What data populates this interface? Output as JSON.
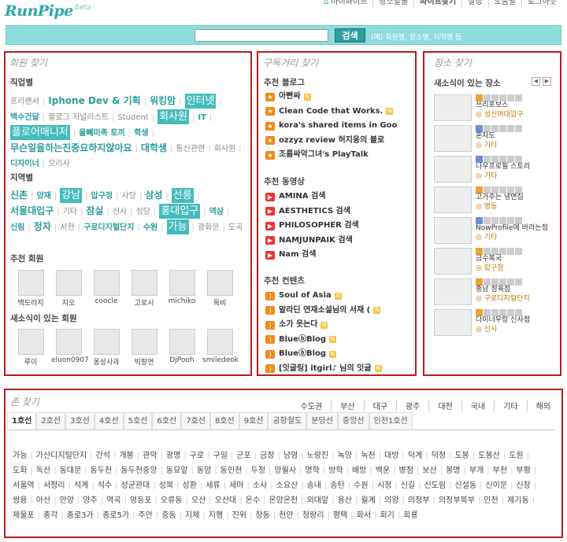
{
  "brand": {
    "name": "RunPipe",
    "beta": "Beta"
  },
  "topnav": [
    "마이파이프",
    "장소발굴",
    "파이프찾기",
    "설정",
    "도움말",
    "로그아웃"
  ],
  "search": {
    "button": "검색",
    "hint": "(예) 회원명, 장소명, 지역명 등",
    "placeholder": ""
  },
  "member": {
    "title": "회원 찾기",
    "job_title": "직업별",
    "jobs": [
      [
        "프리랜서",
        1
      ],
      [
        "Iphone Dev & 기획",
        3
      ],
      [
        "워킹맘",
        3
      ],
      [
        "인터넷",
        4
      ],
      [
        "백수건달",
        2
      ],
      [
        "블로그 저널리스트",
        1
      ],
      [
        "Student",
        1
      ],
      [
        "회사원",
        4
      ],
      [
        "IT",
        2
      ],
      [
        "플로어매니저",
        4
      ],
      [
        "올빼미족 토끼",
        2
      ],
      [
        "학생",
        2
      ],
      [
        "무슨일을하는진중요하지않아요",
        3
      ],
      [
        "대학생",
        3
      ],
      [
        "통신관련",
        1
      ],
      [
        "회사원",
        1
      ],
      [
        "디자이너",
        2
      ],
      [
        "오리사",
        1
      ]
    ],
    "region_title": "지역별",
    "regions": [
      [
        "신촌",
        3
      ],
      [
        "양재",
        2
      ],
      [
        "강남",
        4
      ],
      [
        "압구정",
        2
      ],
      [
        "사당",
        1
      ],
      [
        "삼성",
        3
      ],
      [
        "선릉",
        4
      ],
      [
        "서울대입구",
        3
      ],
      [
        "기타",
        1
      ],
      [
        "잠실",
        3
      ],
      [
        "신사",
        1
      ],
      [
        "성당",
        1
      ],
      [
        "홍대입구",
        4
      ],
      [
        "역삼",
        2
      ],
      [
        "신림",
        2
      ],
      [
        "정자",
        3
      ],
      [
        "서현",
        1
      ],
      [
        "구로디지털단지",
        2
      ],
      [
        "수원",
        2
      ],
      [
        "가능",
        4
      ],
      [
        "광화문",
        1
      ],
      [
        "도곡",
        1
      ]
    ],
    "rec_title": "추천 회원",
    "rec": [
      "백도라지",
      "지오",
      "coocle",
      "고로시",
      "michiko",
      "목비"
    ],
    "new_title": "새소식이 있는 회원",
    "new": [
      "루이",
      "eluon0907",
      "몽상사과",
      "빅팡연",
      "DjPooh",
      "smiledeok"
    ]
  },
  "sub": {
    "title": "구독거리 찾기",
    "blog_title": "추천 블로그",
    "blogs": [
      "아빤싸",
      "Clean Code that Works.",
      "kora's shared items in Goo",
      "ozzyz review 허지웅의 블로",
      "조름싸악그녀's PlayTalk"
    ],
    "video_title": "추천 동영상",
    "videos": [
      "AMINA 검색",
      "AESTHETICS 검색",
      "PHILOSOPHER 검색",
      "NAMJUNPAIK 검색",
      "Nam 검색"
    ],
    "content_title": "추천 컨텐츠",
    "contents": [
      "Soul of Asia",
      "알라딘 연재소설님의 서재 (",
      "소가 웃는다",
      "BlueⓑBlog",
      "BlueⓑBlog",
      "[잇글링] itgirl♪ 님의 잇글"
    ]
  },
  "place": {
    "title": "장소 찾기",
    "news_title": "새소식이 있는 장소",
    "items": [
      {
        "name": "쓰리포보스",
        "cat": "성신여대입구",
        "badge": "food"
      },
      {
        "name": "혼자도",
        "cat": "기타",
        "badge": "etc"
      },
      {
        "name": "나우프로필 스토리",
        "cat": "기타",
        "badge": "etc"
      },
      {
        "name": "고가주는 냉면집",
        "cat": "명동",
        "badge": "food"
      },
      {
        "name": "NowProfile에 바라는점",
        "cat": "기타",
        "badge": "etc"
      },
      {
        "name": "금수복국",
        "cat": "압구정",
        "badge": "food"
      },
      {
        "name": "충남 정육점",
        "cat": "구로디지털단지",
        "badge": "food"
      },
      {
        "name": "다이너우랑 신사점",
        "cat": "신사",
        "badge": "food"
      }
    ]
  },
  "subway": {
    "title": "존 찾기",
    "regions": [
      "수도권",
      "부산",
      "대구",
      "광주",
      "대전",
      "국내",
      "기타",
      "해외"
    ],
    "lines": [
      "1호선",
      "2호선",
      "3호선",
      "4호선",
      "5호선",
      "6호선",
      "7호선",
      "8호선",
      "9호선",
      "공항철도",
      "분당선",
      "중앙선",
      "인천1호선"
    ],
    "stations": [
      "가능",
      "가산디지털단지",
      "간석",
      "개봉",
      "관악",
      "광명",
      "구로",
      "구일",
      "군포",
      "금정",
      "남영",
      "노량진",
      "녹양",
      "녹천",
      "대방",
      "덕계",
      "덕정",
      "도봉",
      "도봉산",
      "도원",
      "도화",
      "독산",
      "동대문",
      "동두천",
      "동두천중앙",
      "동묘앞",
      "동암",
      "동인천",
      "두정",
      "망월사",
      "명학",
      "방학",
      "배방",
      "백운",
      "병점",
      "보산",
      "봉명",
      "부개",
      "부천",
      "부평",
      "서울역",
      "서정리",
      "석계",
      "석수",
      "성균관대",
      "성북",
      "성환",
      "세류",
      "세마",
      "소사",
      "소요산",
      "송내",
      "송탄",
      "수원",
      "시청",
      "신길",
      "신도림",
      "신설동",
      "신이문",
      "신창",
      "쌍용",
      "아산",
      "안양",
      "양주",
      "역곡",
      "영등포",
      "오류동",
      "오산",
      "오산대",
      "온수",
      "온양온천",
      "외대앞",
      "용산",
      "월계",
      "의왕",
      "의정부",
      "의정부북부",
      "인천",
      "제기동",
      "제물포",
      "종각",
      "종로3가",
      "종로5가",
      "주안",
      "중동",
      "지제",
      "지행",
      "진위",
      "창동",
      "천안",
      "청량리",
      "평택",
      "화서",
      "회기",
      "회룡"
    ]
  }
}
